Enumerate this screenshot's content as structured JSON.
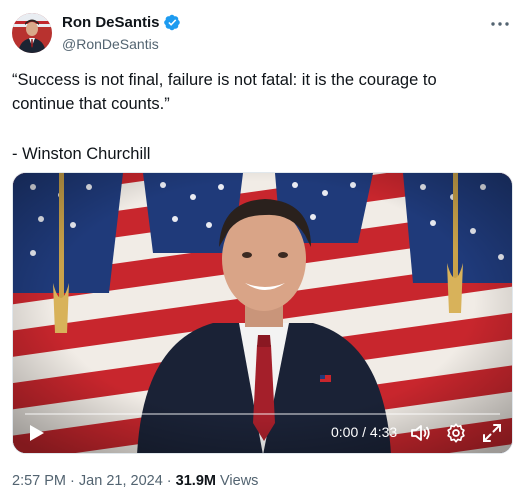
{
  "author": {
    "name": "Ron DeSantis",
    "handle": "@RonDeSantis",
    "verified": true,
    "avatar_icon": "profile-photo"
  },
  "tweet": {
    "line1": "“Success is not final, failure is not fatal: it is the courage to",
    "line2": "continue that counts.”",
    "attribution": "- Winston Churchill"
  },
  "video": {
    "time_display": "0:00 / 4:33",
    "progress": 0.0,
    "controls": [
      "play-icon",
      "volume-icon",
      "settings-icon",
      "fullscreen-icon"
    ]
  },
  "meta": {
    "time": "2:57 PM",
    "separator": "·",
    "date": "Jan 21, 2024",
    "views_count": "31.9M",
    "views_label": "Views"
  },
  "colors": {
    "text": "#0f1419",
    "secondary": "#536471",
    "verified_blue": "#1d9bf0"
  }
}
